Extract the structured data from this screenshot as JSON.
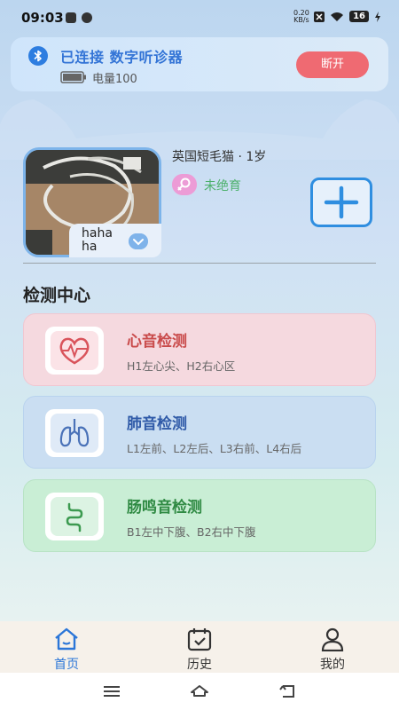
{
  "status_bar": {
    "time": "09:03",
    "net_speed_value": "0.20",
    "net_speed_unit": "KB/s",
    "battery": "16"
  },
  "connection": {
    "status_text": "已连接 数字听诊器",
    "battery_label": "电量100",
    "battery_level": 1.0,
    "disconnect_label": "断开",
    "accent_color": "#3374d6",
    "disconnect_color": "#ef6a72"
  },
  "pet": {
    "name": "hahaha",
    "breed_age": "英国短毛猫 · 1岁",
    "neuter_status": "未绝育",
    "gender_icon": "female-icon"
  },
  "section_title": "检测中心",
  "detections": [
    {
      "title": "心音检测",
      "desc": "H1左心尖、H2右心区",
      "icon": "heart-pulse-icon",
      "color": "#c94b4b"
    },
    {
      "title": "肺音检测",
      "desc": "L1左前、L2左后、L3右前、L4右后",
      "icon": "lungs-icon",
      "color": "#2f5aa8"
    },
    {
      "title": "肠鸣音检测",
      "desc": "B1左中下腹、B2右中下腹",
      "icon": "intestine-icon",
      "color": "#2f8a43"
    }
  ],
  "nav": [
    {
      "label": "首页",
      "icon": "home-icon",
      "active": true
    },
    {
      "label": "历史",
      "icon": "calendar-check-icon",
      "active": false
    },
    {
      "label": "我的",
      "icon": "user-icon",
      "active": false
    }
  ]
}
